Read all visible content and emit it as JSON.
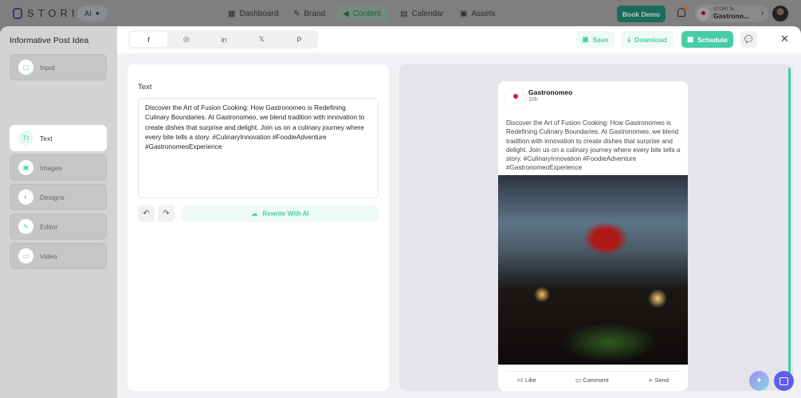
{
  "nav": {
    "brand": "STORI",
    "ai_label": "AI",
    "items": [
      {
        "label": "Dashboard",
        "icon": "dashboard-icon"
      },
      {
        "label": "Brand",
        "icon": "brush-icon"
      },
      {
        "label": "Content",
        "icon": "megaphone-icon",
        "active": true
      },
      {
        "label": "Calendar",
        "icon": "calendar-icon"
      },
      {
        "label": "Assets",
        "icon": "image-icon"
      }
    ],
    "book_demo": "Book Demo",
    "account_team": "STORI Te...",
    "account_name": "Gastrono..."
  },
  "sidebar": {
    "title": "Informative Post Idea",
    "items": [
      {
        "label": "Input",
        "icon": "note-icon"
      },
      {
        "label": "Text",
        "icon": "text-icon",
        "active": true
      },
      {
        "label": "Images",
        "icon": "images-icon"
      },
      {
        "label": "Designs",
        "icon": "palette-icon"
      },
      {
        "label": "Editor",
        "icon": "pencil-icon"
      },
      {
        "label": "Video",
        "icon": "video-icon"
      }
    ]
  },
  "header": {
    "tabs": [
      {
        "icon": "facebook-icon",
        "glyph": "f"
      },
      {
        "icon": "instagram-icon",
        "glyph": "◎"
      },
      {
        "icon": "linkedin-icon",
        "glyph": "in"
      },
      {
        "icon": "x-icon",
        "glyph": "𝕏"
      },
      {
        "icon": "pinterest-icon",
        "glyph": "P"
      }
    ],
    "save": "Save",
    "download": "Download",
    "schedule": "Schedule"
  },
  "editor": {
    "label": "Text",
    "text": "Discover the Art of Fusion Cooking: How Gastronomeo is Redefining Culinary Boundaries. At Gastronomeo, we blend tradition with innovation to create dishes that surprise and delight. Join us on a culinary journey where every bite tells a story. #CulinaryInnovation #FoodieAdventure #GastronomeoExperience",
    "rewrite": "Rewrite With AI"
  },
  "preview": {
    "name": "Gastronomeo",
    "time": "10h",
    "text": "Discover the Art of Fusion Cooking: How Gastronomeo is Redefining Culinary Boundaries. At Gastronomeo, we blend tradition with innovation to create dishes that surprise and delight. Join us on a culinary journey where every bite tells a story. #CulinaryInnovation #FoodieAdventure #GastronomeoExperience",
    "like": "Like",
    "comment": "Comment",
    "send": "Send"
  }
}
